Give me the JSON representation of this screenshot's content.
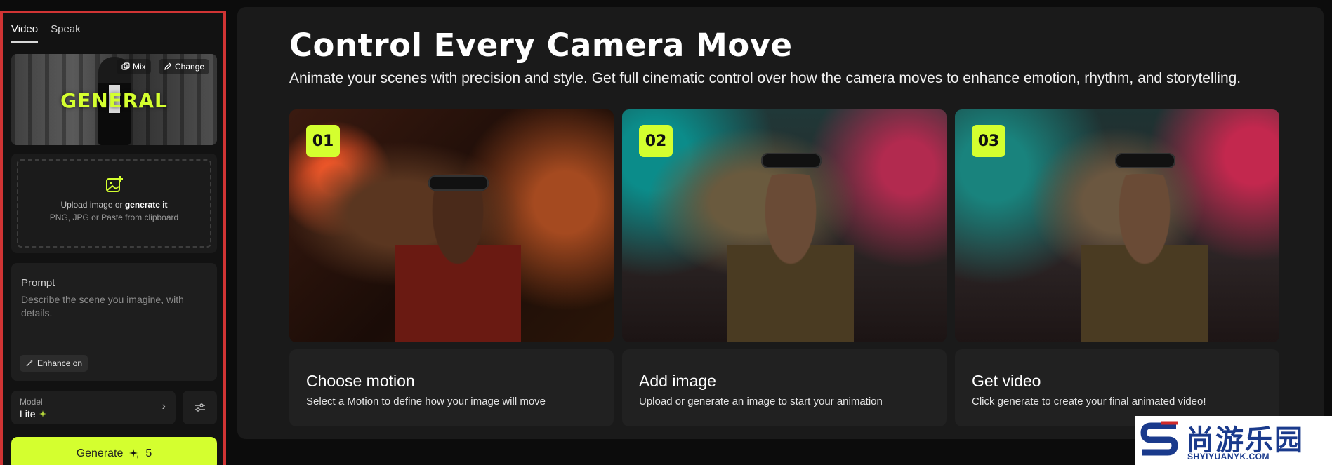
{
  "left_panel": {
    "tabs": [
      {
        "label": "Video",
        "active": true
      },
      {
        "label": "Speak",
        "active": false
      }
    ],
    "preview": {
      "overlay_text": "GENERAL",
      "mix_label": "Mix",
      "change_label": "Change"
    },
    "upload": {
      "text_prefix": "Upload image or ",
      "text_link": "generate it",
      "formats": "PNG, JPG or Paste from clipboard",
      "icon": "image-plus-icon"
    },
    "prompt": {
      "label": "Prompt",
      "placeholder": "Describe the scene you imagine, with details.",
      "enhance_label": "Enhance on"
    },
    "model": {
      "label": "Model",
      "value": "Lite"
    },
    "generate": {
      "label": "Generate",
      "cost": "5"
    }
  },
  "main": {
    "title": "Control Every Camera Move",
    "subtitle": "Animate your scenes with precision and style. Get full cinematic control over how the camera moves to enhance emotion, rhythm, and storytelling.",
    "cards": [
      {
        "badge": "01",
        "title": "Choose motion",
        "description": "Select a Motion to define how your image will move"
      },
      {
        "badge": "02",
        "title": "Add image",
        "description": "Upload or generate an image to start your animation"
      },
      {
        "badge": "03",
        "title": "Get video",
        "description": "Click generate to create your final animated video!"
      }
    ]
  },
  "watermark": {
    "chinese": "尚游乐园",
    "url": "SHYIYUANYK.COM"
  },
  "colors": {
    "accent": "#d4ff2f",
    "panel": "#1a1a1a",
    "highlight_border": "#d03434"
  }
}
